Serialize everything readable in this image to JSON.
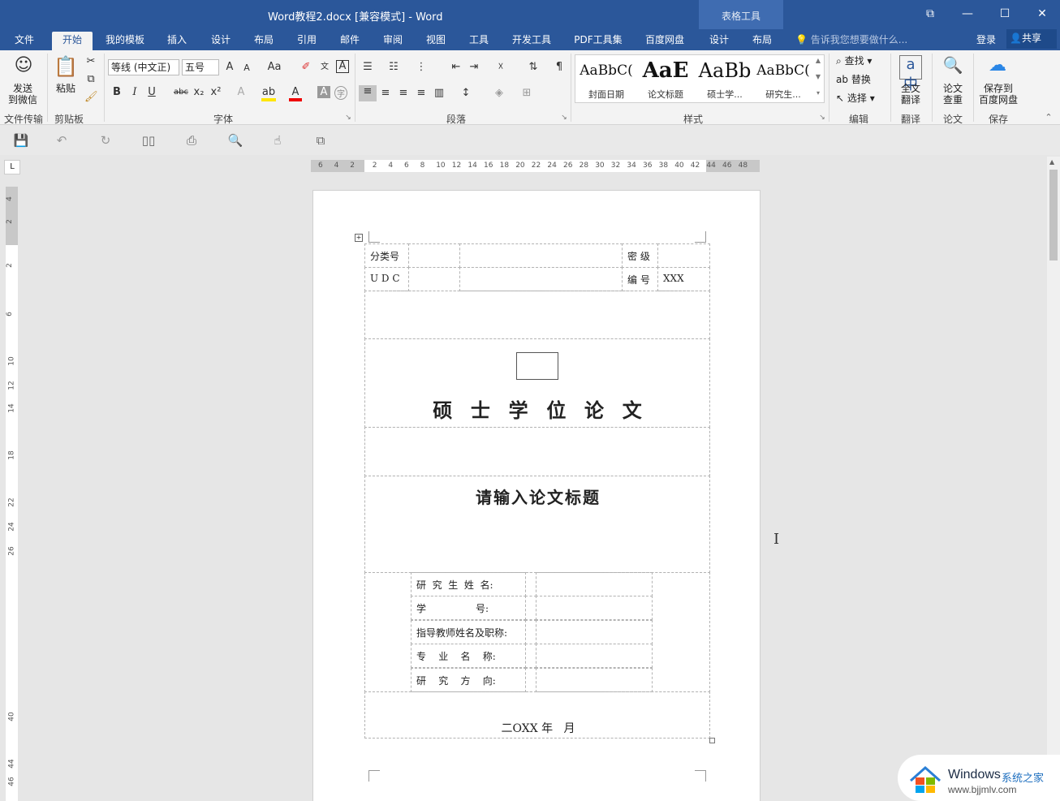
{
  "window": {
    "title": "Word教程2.docx [兼容模式] - Word",
    "context_title": "表格工具",
    "controls": [
      "⧉",
      "—",
      "☐",
      "✕"
    ]
  },
  "tabs": [
    {
      "label": "文件",
      "x": 20
    },
    {
      "label": "开始",
      "active": true
    },
    {
      "label": "我的模板"
    },
    {
      "label": "插入"
    },
    {
      "label": "设计"
    },
    {
      "label": "布局"
    },
    {
      "label": "引用"
    },
    {
      "label": "邮件"
    },
    {
      "label": "审阅"
    },
    {
      "label": "视图"
    },
    {
      "label": "工具"
    },
    {
      "label": "开发工具"
    },
    {
      "label": "PDF工具集"
    },
    {
      "label": "百度网盘"
    },
    {
      "label": "设计"
    },
    {
      "label": "布局"
    }
  ],
  "tellme": "告诉我您想要做什么...",
  "login": "登录",
  "share": "共享",
  "ribbon": {
    "send_wechat": "发送\n到微信",
    "paste": "粘贴",
    "font_name": "等线 (中文正)",
    "font_size": "五号",
    "style_items": [
      {
        "sample": "AaBbC(",
        "name": "封面日期"
      },
      {
        "sample": "AaE",
        "name": "论文标题"
      },
      {
        "sample": "AaBb",
        "name": "硕士学..."
      },
      {
        "sample": "AaBbC(",
        "name": "研究生..."
      }
    ],
    "find": "查找",
    "replace": "替换",
    "select": "选择",
    "translate_full": "全文\n翻译",
    "paper_check": "论文\n查重",
    "save_baidu": "保存到\n百度网盘",
    "groups": {
      "file_transfer": "文件传输",
      "clipboard": "剪贴板",
      "font": "字体",
      "paragraph": "段落",
      "styles": "样式",
      "editing": "编辑",
      "translate": "翻译",
      "paper": "论文",
      "save": "保存"
    }
  },
  "ruler": {
    "h_ticks": [
      "6",
      "4",
      "2",
      "2",
      "4",
      "6",
      "8",
      "10",
      "12",
      "14",
      "16",
      "18",
      "20",
      "22",
      "24",
      "26",
      "28",
      "30",
      "32",
      "34",
      "36",
      "38",
      "40",
      "42",
      "44",
      "46",
      "48"
    ],
    "v_ticks": [
      "4",
      "2",
      "2",
      "6",
      "10",
      "12",
      "14",
      "18",
      "22",
      "24",
      "26",
      "40",
      "44",
      "46"
    ]
  },
  "doc": {
    "cls_label": "分类号",
    "secret_label": "密  级",
    "udc_label": "U D C",
    "num_label": "编  号",
    "num_value": "XXX",
    "degree_title": "硕  士  学  位  论  文",
    "thesis_title": "请输入论文标题",
    "info_rows": [
      {
        "label": "研  究  生  姓  名:"
      },
      {
        "label": "学                号:"
      },
      {
        "label": "指导教师姓名及职称:"
      },
      {
        "label": "专    业    名    称:"
      },
      {
        "label": "研    究    方    向:"
      }
    ],
    "date": "二OXX 年   月"
  },
  "watermark": {
    "brand": "Windows",
    "brand_cn": "系统之家",
    "url": "www.bjjmlv.com"
  }
}
